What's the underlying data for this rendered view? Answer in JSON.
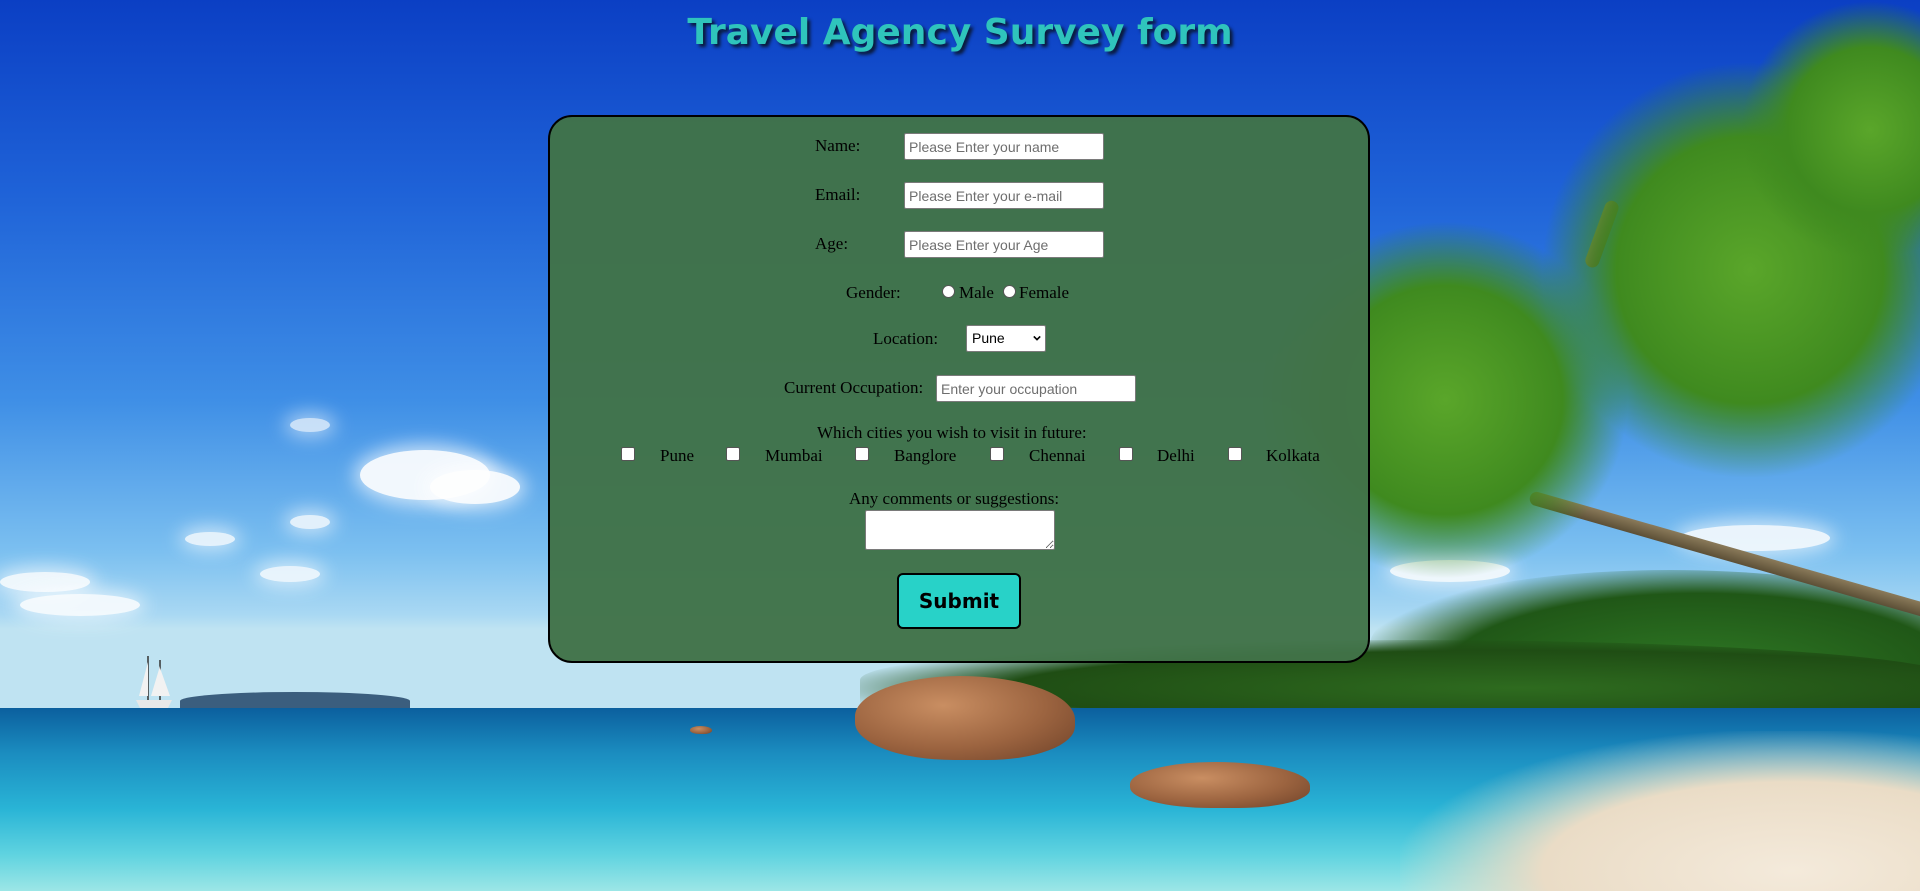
{
  "title": "Travel Agency Survey form",
  "form": {
    "name": {
      "label": "Name:",
      "placeholder": "Please Enter your name"
    },
    "email": {
      "label": "Email:",
      "placeholder": "Please Enter your e-mail"
    },
    "age": {
      "label": "Age:",
      "placeholder": "Please Enter your Age"
    },
    "gender": {
      "label": "Gender:",
      "options": [
        "Male",
        "Female"
      ]
    },
    "location": {
      "label": "Location:",
      "selected": "Pune"
    },
    "occupation": {
      "label": "Current Occupation:",
      "placeholder": "Enter your occupation"
    },
    "cities": {
      "label": "Which cities you wish to visit in future:",
      "options": [
        "Pune",
        "Mumbai",
        "Banglore",
        "Chennai",
        "Delhi",
        "Kolkata"
      ]
    },
    "comments": {
      "label": "Any comments or suggestions:"
    },
    "submit_label": "Submit"
  }
}
